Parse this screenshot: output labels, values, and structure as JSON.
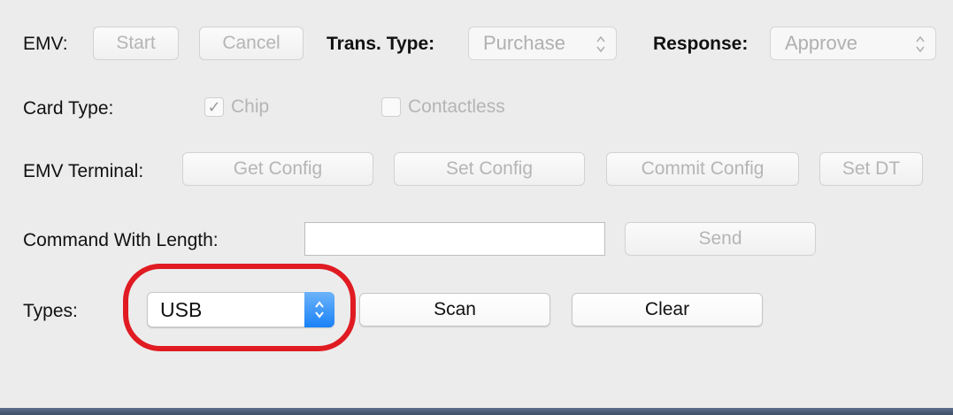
{
  "emv_row": {
    "label": "EMV:",
    "start_label": "Start",
    "cancel_label": "Cancel",
    "trans_type_label": "Trans. Type:",
    "trans_type_value": "Purchase",
    "response_label": "Response:",
    "response_value": "Approve"
  },
  "card_row": {
    "label": "Card Type:",
    "chip_label": "Chip",
    "chip_checked": true,
    "contactless_label": "Contactless",
    "contactless_checked": false,
    "check_mark": "✓"
  },
  "terminal_row": {
    "label": "EMV Terminal:",
    "get_config_label": "Get Config",
    "set_config_label": "Set Config",
    "commit_config_label": "Commit Config",
    "set_dt_label": "Set DT"
  },
  "command_row": {
    "label": "Command With Length:",
    "input_value": "",
    "send_label": "Send"
  },
  "types_row": {
    "label": "Types:",
    "selected_value": "USB",
    "scan_label": "Scan",
    "clear_label": "Clear"
  },
  "colors": {
    "highlight": "#e01b22",
    "accent_blue": "#1a82f7",
    "disabled_text": "#b5b5b5"
  },
  "icons": [
    "up-down-chevron-icon",
    "checkmark-icon"
  ]
}
